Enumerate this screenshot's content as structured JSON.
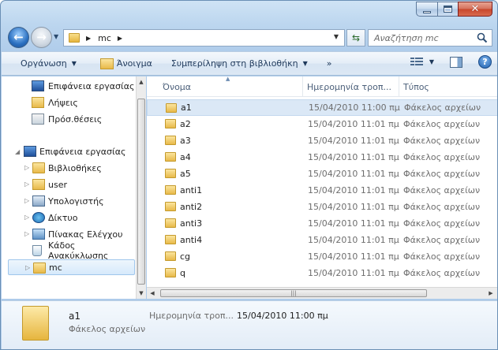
{
  "address": {
    "segments": [
      "mc"
    ]
  },
  "search": {
    "placeholder": "Αναζήτηση mc"
  },
  "toolbar": {
    "organize": "Οργάνωση",
    "open": "Άνοιγμα",
    "include": "Συμπερίληψη στη βιβλιοθήκη",
    "more": "»"
  },
  "navpane": {
    "favorites": [
      "Επιφάνεια εργασίας",
      "Λήψεις",
      "Πρόσ.θέσεις"
    ],
    "tree": [
      {
        "label": "Επιφάνεια εργασίας",
        "icon": "desktop-icon"
      },
      {
        "label": "Βιβλιοθήκες",
        "icon": "library-icon"
      },
      {
        "label": "user",
        "icon": "user-folder-icon"
      },
      {
        "label": "Υπολογιστής",
        "icon": "computer-icon"
      },
      {
        "label": "Δίκτυο",
        "icon": "network-icon"
      },
      {
        "label": "Πίνακας Ελέγχου",
        "icon": "control-panel-icon"
      },
      {
        "label": "Κάδος Ανακύκλωσης",
        "icon": "recycle-bin-icon"
      },
      {
        "label": "mc",
        "icon": "folder-icon"
      }
    ]
  },
  "columns": {
    "name": "Όνομα",
    "date": "Ημερομηνία τροπ...",
    "type": "Τύπος"
  },
  "files": [
    {
      "name": "a1",
      "date": "15/04/2010 11:00 πμ",
      "type": "Φάκελος αρχείων"
    },
    {
      "name": "a2",
      "date": "15/04/2010 11:01 πμ",
      "type": "Φάκελος αρχείων"
    },
    {
      "name": "a3",
      "date": "15/04/2010 11:01 πμ",
      "type": "Φάκελος αρχείων"
    },
    {
      "name": "a4",
      "date": "15/04/2010 11:01 πμ",
      "type": "Φάκελος αρχείων"
    },
    {
      "name": "a5",
      "date": "15/04/2010 11:01 πμ",
      "type": "Φάκελος αρχείων"
    },
    {
      "name": "anti1",
      "date": "15/04/2010 11:01 πμ",
      "type": "Φάκελος αρχείων"
    },
    {
      "name": "anti2",
      "date": "15/04/2010 11:01 πμ",
      "type": "Φάκελος αρχείων"
    },
    {
      "name": "anti3",
      "date": "15/04/2010 11:01 πμ",
      "type": "Φάκελος αρχείων"
    },
    {
      "name": "anti4",
      "date": "15/04/2010 11:01 πμ",
      "type": "Φάκελος αρχείων"
    },
    {
      "name": "cg",
      "date": "15/04/2010 11:01 πμ",
      "type": "Φάκελος αρχείων"
    },
    {
      "name": "q",
      "date": "15/04/2010 11:01 πμ",
      "type": "Φάκελος αρχείων"
    }
  ],
  "details": {
    "name": "a1",
    "type": "Φάκελος αρχείων",
    "date_label": "Ημερομηνία τροπ...",
    "date_value": "15/04/2010 11:00 πμ"
  }
}
